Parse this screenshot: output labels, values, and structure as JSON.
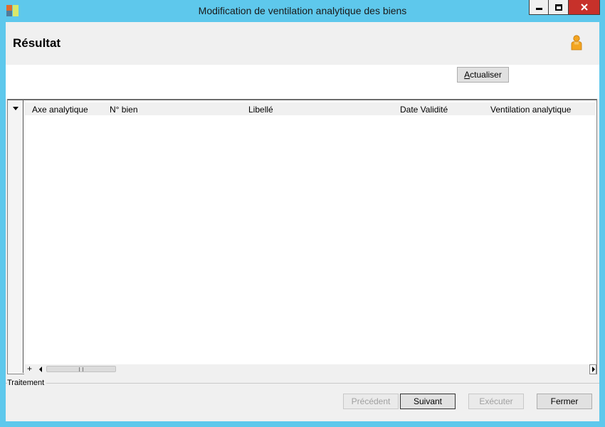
{
  "window": {
    "title": "Modification de ventilation analytique des biens",
    "minimize_icon": "minimize-icon",
    "maximize_icon": "maximize-icon",
    "close_icon": "close-icon"
  },
  "header": {
    "title": "Résultat",
    "user_icon": "user-icon"
  },
  "toolbar": {
    "refresh_label_accel": "A",
    "refresh_label_rest": "ctualiser"
  },
  "grid": {
    "columns": [
      "Axe analytique",
      "N° bien",
      "Libellé",
      "Date Validité",
      "Ventilation analytique"
    ],
    "rows": [],
    "add_label": "+"
  },
  "traitement": {
    "label": "Traitement"
  },
  "footer": {
    "prev_label": "Précédent",
    "next_label": "Suivant",
    "exec_label": "Exécuter",
    "close_label": "Fermer"
  },
  "colors": {
    "title_bar": "#5ec8ec",
    "close_button": "#c7312a",
    "panel": "#f0f0f0"
  }
}
